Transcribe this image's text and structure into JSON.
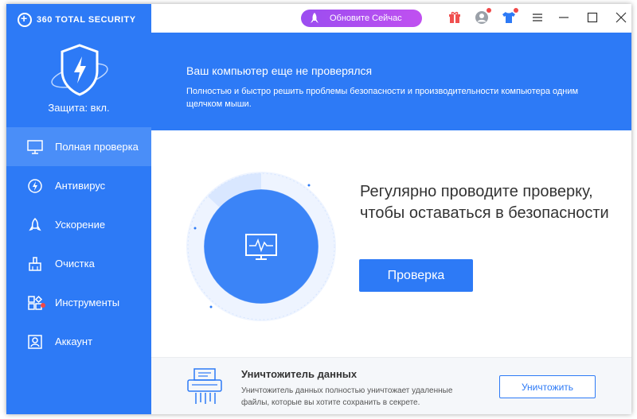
{
  "app": {
    "brand": "360 TOTAL SECURITY",
    "protection_status": "Защита: вкл."
  },
  "titlebar": {
    "update_label": "Обновите Сейчас",
    "icons": [
      "gift-icon",
      "user-icon",
      "skin-icon",
      "menu-icon",
      "minimize-icon",
      "maximize-icon",
      "close-icon"
    ]
  },
  "sidebar": {
    "items": [
      {
        "label": "Полная проверка",
        "icon": "monitor-icon",
        "active": true
      },
      {
        "label": "Антивирус",
        "icon": "antivirus-icon"
      },
      {
        "label": "Ускорение",
        "icon": "rocket-icon"
      },
      {
        "label": "Очистка",
        "icon": "broom-icon"
      },
      {
        "label": "Инструменты",
        "icon": "tools-icon",
        "badge": true
      },
      {
        "label": "Аккаунт",
        "icon": "account-icon"
      }
    ]
  },
  "banner": {
    "title": "Ваш компьютер еще не проверялся",
    "subtitle": "Полностью и быстро решить проблемы безопасности и производительности компьютера одним щелчком мыши."
  },
  "main": {
    "headline": "Регулярно проводите проверку, чтобы оставаться в безопасности",
    "scan_button": "Проверка"
  },
  "shredder": {
    "title": "Уничтожитель данных",
    "description": "Уничтожитель данных  полностью уничтожает удаленные файлы, которые вы хотите сохранить в секрете.",
    "button": "Уничтожить"
  },
  "colors": {
    "primary": "#2d7af6",
    "active_nav": "#4a8ef8",
    "update_gradient": "#9b4df0",
    "badge": "#f04848"
  }
}
